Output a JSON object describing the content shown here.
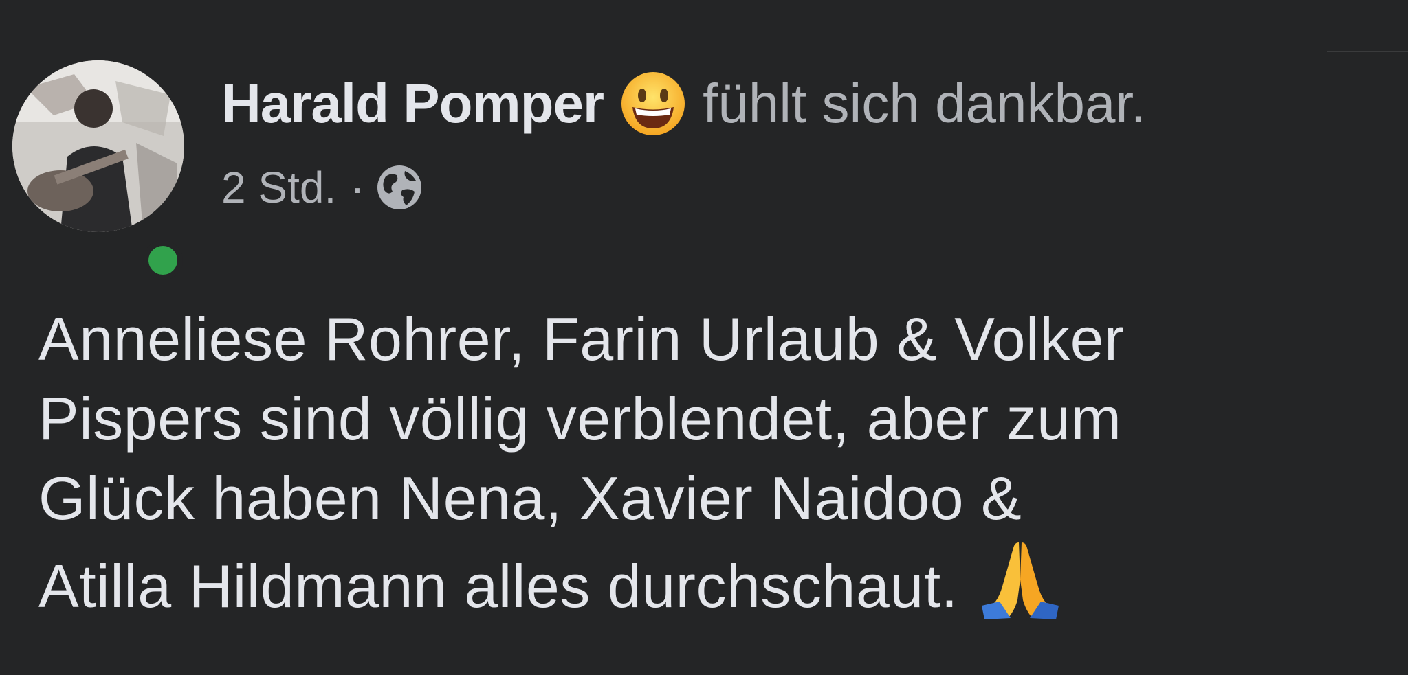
{
  "post": {
    "author": "Harald Pomper",
    "feeling_icon": "grinning-face-emoji",
    "feeling_text": "fühlt sich dankbar.",
    "timestamp": "2 Std.",
    "separator": "·",
    "audience_icon": "globe-icon",
    "online": true,
    "body_lines": [
      "Anneliese Rohrer, Farin Urlaub & Volker",
      "Pispers sind völlig verblendet, aber zum",
      "Glück haben Nena, Xavier Naidoo &",
      "Atilla Hildmann alles durchschaut."
    ],
    "trailing_emoji": "folded-hands-emoji"
  },
  "colors": {
    "background": "#242526",
    "primary_text": "#e4e6eb",
    "secondary_text": "#b0b3b8",
    "online_green": "#31a24c"
  }
}
